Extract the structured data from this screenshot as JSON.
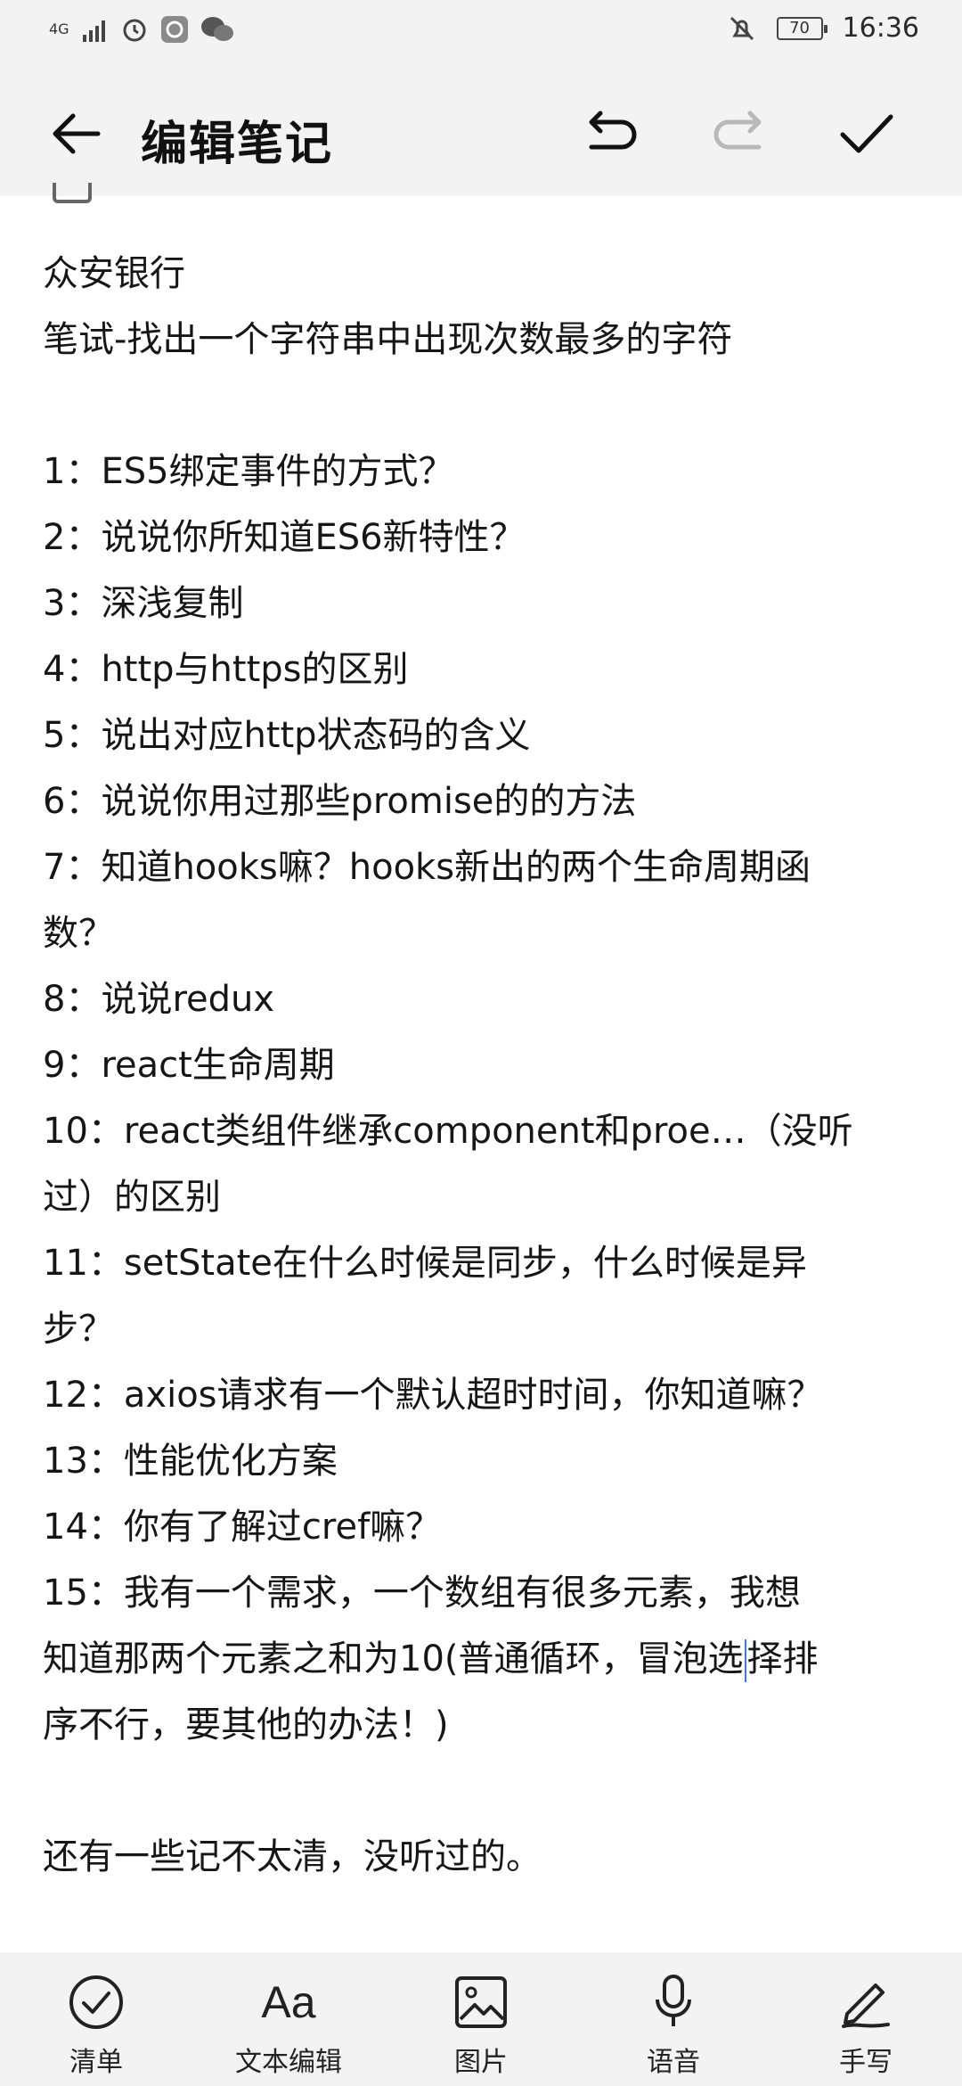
{
  "status_bar": {
    "network_type": "4G",
    "battery": "70",
    "time": "16:36"
  },
  "header": {
    "title": "编辑笔记",
    "back_icon": "arrow-left-icon",
    "undo_icon": "undo-icon",
    "redo_icon": "redo-icon",
    "confirm_icon": "check-icon"
  },
  "note": {
    "lines": [
      "众安银行",
      "笔试-找出一个字符串中出现次数最多的字符",
      "",
      "1：ES5绑定事件的方式？",
      "2：说说你所知道ES6新特性？",
      "3：深浅复制",
      "4：http与https的区别",
      "5：说出对应http状态码的含义",
      "6：说说你用过那些promise的的方法",
      "7：知道hooks嘛？hooks新出的两个生命周期函",
      "数？",
      "8：说说redux",
      "9：react生命周期",
      "10：react类组件继承component和proe…（没听",
      "过）的区别",
      "11：setState在什么时候是同步，什么时候是异",
      "步？",
      "12：axios请求有一个默认超时时间，你知道嘛？",
      "13：性能优化方案",
      "14：你有了解过cref嘛？",
      "15：我有一个需求，一个数组有很多元素，我想",
      "知道那两个元素之和为10(普通循环，冒泡选",
      "序不行，要其他的办法！)",
      "",
      "还有一些记不太清，没听过的。"
    ],
    "line_21_tail": "择排"
  },
  "toolbar": {
    "items": [
      {
        "label": "清单",
        "icon": "checklist-icon"
      },
      {
        "label": "文本编辑",
        "icon": "text-format-icon",
        "glyph": "Aa"
      },
      {
        "label": "图片",
        "icon": "image-icon"
      },
      {
        "label": "语音",
        "icon": "microphone-icon"
      },
      {
        "label": "手写",
        "icon": "handwriting-icon"
      }
    ]
  }
}
